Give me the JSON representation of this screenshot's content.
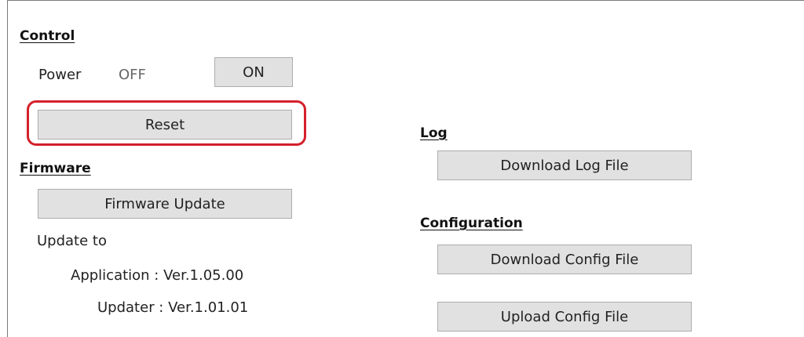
{
  "control": {
    "heading": "Control",
    "power_label": "Power",
    "power_state": "OFF",
    "on_button": "ON",
    "reset_button": "Reset"
  },
  "firmware": {
    "heading": "Firmware",
    "update_button": "Firmware Update",
    "update_to_label": "Update to",
    "application_version": "Application : Ver.1.05.00",
    "updater_version": "Updater : Ver.1.01.01"
  },
  "log": {
    "heading": "Log",
    "download_button": "Download Log File"
  },
  "configuration": {
    "heading": "Configuration",
    "download_button": "Download Config File",
    "upload_button": "Upload Config File"
  },
  "highlight_color": "#d4202c"
}
